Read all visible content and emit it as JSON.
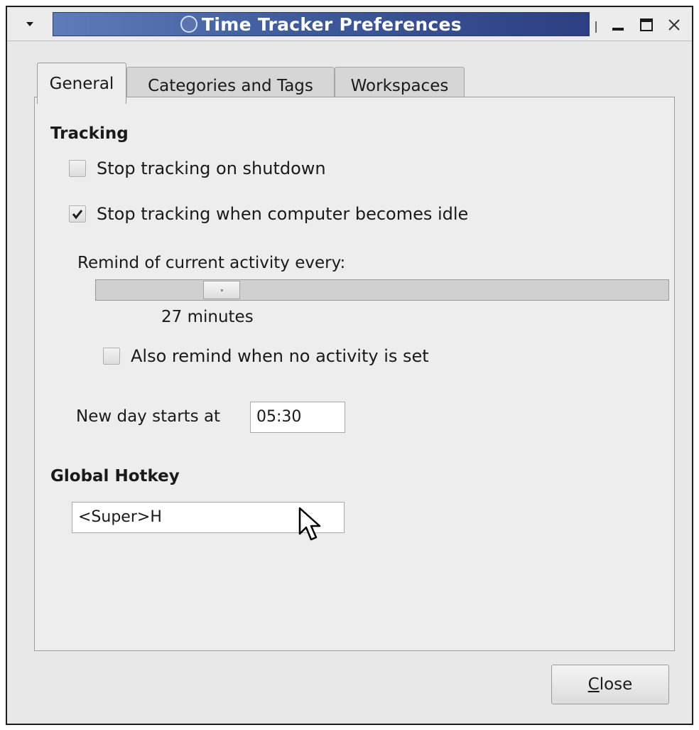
{
  "window": {
    "title": "Time Tracker Preferences"
  },
  "titlebar_icons": {
    "menu": "dropdown-arrow-icon",
    "app": "circle-app-icon",
    "minimize": "minimize-icon",
    "maximize": "maximize-icon",
    "close": "close-x-icon"
  },
  "tabs": [
    {
      "label": "General",
      "active": true
    },
    {
      "label": "Categories and Tags",
      "active": false
    },
    {
      "label": "Workspaces",
      "active": false
    }
  ],
  "tracking": {
    "header": "Tracking",
    "stop_on_shutdown": {
      "label": "Stop tracking on shutdown",
      "checked": false
    },
    "stop_on_idle": {
      "label": "Stop tracking when computer becomes idle",
      "checked": true
    },
    "remind_label": "Remind of current activity every:",
    "remind_slider": {
      "value_fraction": 0.2
    },
    "remind_value": "27 minutes",
    "remind_no_activity": {
      "label": "Also remind when no activity is set",
      "checked": false
    },
    "new_day_label": "New day starts at",
    "new_day_value": "05:30"
  },
  "hotkey": {
    "header": "Global Hotkey",
    "value": "<Super>H"
  },
  "buttons": {
    "close_mnemonic": "C",
    "close_rest": "lose"
  },
  "colors": {
    "titlebar_gradient_start": "#5e7cba",
    "titlebar_gradient_end": "#2c3f82",
    "window_bg": "#e8e8e8"
  }
}
